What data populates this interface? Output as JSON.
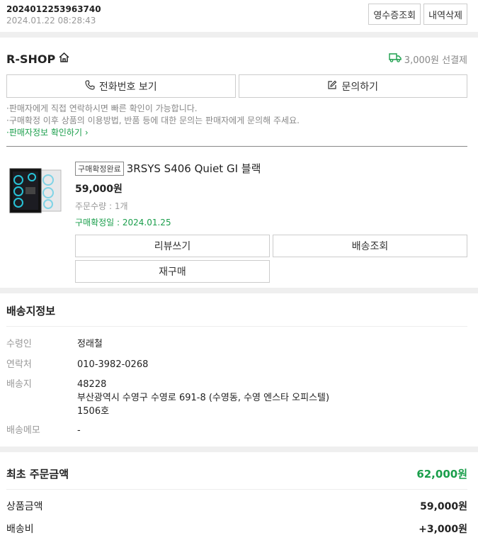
{
  "order": {
    "number": "2024012253963740",
    "datetime": "2024.01.22 08:28:43",
    "receipt_label": "영수증조회",
    "delete_label": "내역삭제"
  },
  "shop": {
    "name": "R-SHOP",
    "shipping_fee": "3,000원 선결제",
    "phone_label": "전화번호 보기",
    "inquiry_label": "문의하기",
    "notes": [
      "판매자에게 직접 연락하시면 빠른 확인이 가능합니다.",
      "구매확정 이후 상품의 이용방법, 반품 등에 대한 문의는 판매자에게 문의해 주세요."
    ],
    "seller_info_link": "판매자정보 확인하기"
  },
  "product": {
    "status": "구매확정완료",
    "name": "3RSYS S406 Quiet GI 블랙",
    "price": "59,000원",
    "quantity": "주문수량 : 1개",
    "confirmed": "구매확정일 : 2024.01.25",
    "actions": {
      "review": "리뷰쓰기",
      "tracking": "배송조회",
      "rebuy": "재구매"
    }
  },
  "delivery": {
    "title": "배송지정보",
    "recipient_label": "수령인",
    "recipient": "정래철",
    "contact_label": "연락처",
    "contact": "010-3982-0268",
    "address_label": "배송지",
    "zip": "48228",
    "address1": "부산광역시 수영구 수영로 691-8 (수영동, 수영 엔스타 오피스텔)",
    "address2": "1506호",
    "memo_label": "배송메모",
    "memo": "-"
  },
  "amounts": {
    "title": "최초 주문금액",
    "total": "62,000원",
    "product_label": "상품금액",
    "product": "59,000원",
    "shipping_label": "배송비",
    "shipping": "+3,000원"
  },
  "colors": {
    "accent_green": "#1a9e4b",
    "separator": "#efefef"
  }
}
